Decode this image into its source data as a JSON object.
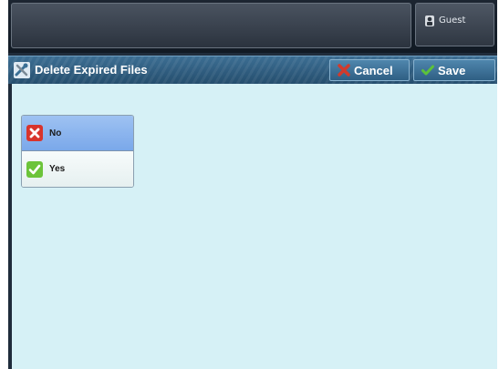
{
  "header": {
    "user_label": "Guest",
    "user_icon": "user-lock-icon"
  },
  "title_bar": {
    "title": "Delete Expired Files",
    "title_icon": "tools-icon",
    "cancel_label": "Cancel",
    "save_label": "Save"
  },
  "options": [
    {
      "label": "No",
      "icon": "x-mark-icon",
      "selected": true
    },
    {
      "label": "Yes",
      "icon": "check-mark-icon",
      "selected": false
    }
  ],
  "colors": {
    "title_bar": "#2f5f84",
    "content_bg": "#d6f1f6",
    "selected_option": "#8db6ef",
    "cancel_icon": "#d23a2c",
    "save_icon": "#5cc23a"
  }
}
